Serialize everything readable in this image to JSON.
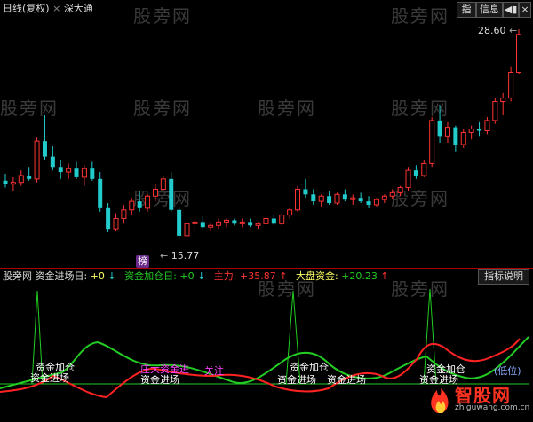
{
  "header": {
    "title": "日线(复权)",
    "market": "深大通",
    "btn_zhi": "指",
    "btn_info": "信息"
  },
  "watermark": "股旁网",
  "price": {
    "high_label": "28.60",
    "low_label": "15.77",
    "bang_badge": "榜"
  },
  "indicator": {
    "name": "股旁网 资金进场日:",
    "val1": "+0",
    "label2": "资金加仓日:",
    "val2": "+0",
    "label3": "主力:",
    "val3": "+35.87",
    "label4": "大盘资金:",
    "val4": "+20.23",
    "help_btn": "指标说明"
  },
  "annotations": [
    {
      "text": "资金加仓"
    },
    {
      "text": "资金进场"
    },
    {
      "text": "庄大资金进"
    },
    {
      "text": "资金进场"
    },
    {
      "text": "资金加仓"
    },
    {
      "text": "资金进场"
    },
    {
      "text": "资金进场"
    },
    {
      "text": "资金加仓"
    },
    {
      "text": "资金进场"
    },
    {
      "text": "关注"
    },
    {
      "text": "(低位)"
    }
  ],
  "logo": {
    "name": "智股网",
    "url": "zhiguwang.com.cn",
    "icon": "flame-icon"
  },
  "colors": {
    "up": "#ff3333",
    "down": "#22cccc",
    "green": "#22cc22",
    "red": "#ff2222",
    "yellow": "#ffff66"
  },
  "chart_data": {
    "type": "candlestick",
    "price_labels": [
      "28.60",
      "15.77"
    ],
    "candles": [
      [
        19.8,
        20.2,
        19.4,
        19.6
      ],
      [
        19.6,
        20.0,
        19.2,
        19.7
      ],
      [
        19.7,
        20.4,
        19.5,
        20.1
      ],
      [
        20.1,
        20.6,
        19.8,
        19.9
      ],
      [
        19.9,
        22.3,
        19.7,
        22.1
      ],
      [
        22.1,
        23.6,
        21.0,
        21.2
      ],
      [
        21.2,
        21.8,
        20.4,
        20.6
      ],
      [
        20.6,
        21.0,
        19.9,
        20.3
      ],
      [
        20.3,
        20.8,
        19.9,
        20.5
      ],
      [
        20.5,
        20.9,
        19.9,
        20.0
      ],
      [
        20.0,
        20.7,
        19.5,
        20.5
      ],
      [
        20.5,
        20.9,
        19.8,
        19.9
      ],
      [
        19.9,
        20.3,
        18.0,
        18.2
      ],
      [
        18.2,
        18.5,
        16.8,
        17.0
      ],
      [
        17.0,
        17.9,
        16.9,
        17.6
      ],
      [
        17.6,
        18.4,
        17.3,
        18.1
      ],
      [
        18.1,
        18.8,
        17.8,
        18.6
      ],
      [
        18.6,
        19.2,
        18.0,
        18.2
      ],
      [
        18.2,
        19.0,
        18.0,
        18.9
      ],
      [
        18.9,
        19.6,
        18.6,
        19.3
      ],
      [
        19.3,
        20.1,
        19.2,
        19.9
      ],
      [
        19.9,
        20.3,
        18.0,
        18.1
      ],
      [
        18.1,
        18.3,
        16.4,
        16.6
      ],
      [
        16.6,
        17.6,
        16.2,
        17.3
      ],
      [
        17.3,
        17.6,
        16.9,
        17.4
      ],
      [
        17.4,
        17.7,
        17.0,
        17.1
      ],
      [
        17.1,
        17.4,
        16.9,
        17.2
      ],
      [
        17.2,
        17.6,
        17.0,
        17.4
      ],
      [
        17.4,
        17.6,
        17.1,
        17.5
      ],
      [
        17.5,
        17.6,
        17.2,
        17.3
      ],
      [
        17.3,
        17.6,
        17.1,
        17.4
      ],
      [
        17.4,
        17.6,
        17.1,
        17.2
      ],
      [
        17.2,
        17.4,
        17.0,
        17.3
      ],
      [
        17.3,
        17.7,
        17.2,
        17.6
      ],
      [
        17.6,
        17.8,
        17.2,
        17.3
      ],
      [
        17.3,
        17.9,
        17.2,
        17.8
      ],
      [
        17.8,
        18.2,
        17.6,
        18.1
      ],
      [
        18.1,
        19.5,
        18.0,
        19.3
      ],
      [
        19.3,
        19.9,
        18.8,
        19.0
      ],
      [
        19.0,
        19.3,
        18.4,
        18.6
      ],
      [
        18.6,
        19.0,
        18.3,
        18.9
      ],
      [
        18.9,
        19.2,
        18.4,
        18.5
      ],
      [
        18.5,
        19.1,
        18.4,
        19.0
      ],
      [
        19.0,
        19.3,
        18.6,
        18.7
      ],
      [
        18.7,
        19.0,
        18.4,
        18.8
      ],
      [
        18.8,
        19.1,
        18.5,
        18.6
      ],
      [
        18.6,
        18.9,
        18.2,
        18.4
      ],
      [
        18.4,
        18.8,
        18.3,
        18.7
      ],
      [
        18.7,
        19.0,
        18.5,
        18.9
      ],
      [
        18.9,
        19.3,
        18.7,
        19.1
      ],
      [
        19.1,
        19.5,
        18.9,
        19.4
      ],
      [
        19.4,
        20.6,
        19.2,
        20.4
      ],
      [
        20.4,
        20.7,
        19.9,
        20.1
      ],
      [
        20.1,
        21.0,
        20.0,
        20.8
      ],
      [
        20.8,
        23.5,
        20.6,
        23.3
      ],
      [
        23.3,
        24.2,
        22.0,
        22.4
      ],
      [
        22.4,
        23.2,
        22.0,
        22.9
      ],
      [
        22.9,
        23.0,
        21.5,
        21.9
      ],
      [
        21.9,
        22.8,
        21.7,
        22.6
      ],
      [
        22.6,
        23.0,
        22.2,
        22.8
      ],
      [
        22.8,
        23.2,
        22.4,
        22.7
      ],
      [
        22.7,
        23.5,
        22.5,
        23.3
      ],
      [
        23.3,
        24.6,
        23.1,
        24.4
      ],
      [
        24.4,
        24.9,
        23.6,
        24.6
      ],
      [
        24.6,
        26.4,
        24.4,
        26.1
      ],
      [
        26.1,
        28.6,
        26.0,
        28.3
      ]
    ],
    "series": [
      {
        "name": "主力",
        "color": "#ff2222"
      },
      {
        "name": "大盘资金",
        "color": "#22cc22"
      }
    ]
  }
}
